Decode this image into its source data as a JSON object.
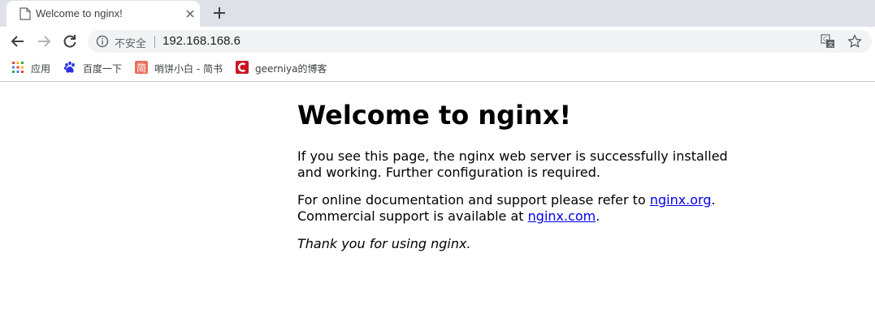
{
  "browser": {
    "tab": {
      "title": "Welcome to nginx!"
    },
    "omnibox": {
      "security_label": "不安全",
      "url": "192.168.168.6"
    },
    "bookmarks": [
      {
        "label": "应用",
        "icon": "apps-grid-icon"
      },
      {
        "label": "百度一下",
        "icon": "baidu-paw-icon"
      },
      {
        "label": "哨饼小白 - 简书",
        "icon": "jianshu-icon"
      },
      {
        "label": "geerniya的博客",
        "icon": "csdn-icon"
      }
    ]
  },
  "page": {
    "heading": "Welcome to nginx!",
    "para1": "If you see this page, the nginx web server is successfully installed and working. Further configuration is required.",
    "para2_prefix": "For online documentation and support please refer to ",
    "para2_link1": "nginx.org",
    "para2_mid": ".",
    "para2_line2_prefix": "Commercial support is available at ",
    "para2_link2": "nginx.com",
    "para2_suffix": ".",
    "para3": "Thank you for using nginx."
  },
  "colors": {
    "tabstrip_bg": "#dee1e6",
    "omnibox_bg": "#f1f3f4",
    "link": "#0000ee",
    "jianshu_red": "#ea6f5a",
    "csdn_red": "#c91623",
    "baidu_blue": "#2932e1"
  }
}
